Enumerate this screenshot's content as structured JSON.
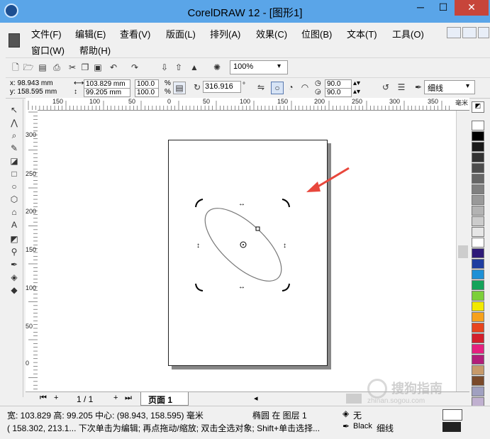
{
  "window": {
    "title": "CorelDRAW 12 - [图形1]",
    "minimize": "─",
    "restore": "☐",
    "close": "✕"
  },
  "menu": {
    "row1": [
      "文件(F)",
      "编辑(E)",
      "查看(V)",
      "版面(L)",
      "排列(A)",
      "效果(C)",
      "位图(B)",
      "文本(T)",
      "工具(O)"
    ],
    "row2": [
      "窗口(W)",
      "帮助(H)"
    ]
  },
  "toolbar": {
    "zoom": "100%",
    "x": "x: 98.943 mm",
    "y": "y: 158.595 mm",
    "width": "103.829 mm",
    "height": "99.205 mm",
    "scale_w": "100.0",
    "scale_h": "100.0",
    "percent": "%",
    "rotation": "316.916",
    "degree": "°",
    "start_angle": "90.0",
    "end_angle": "90.0",
    "outline": "细线"
  },
  "ruler": {
    "unit": "毫米",
    "h_labels": [
      "150",
      "100",
      "50",
      "0",
      "50",
      "100",
      "150",
      "200",
      "250",
      "300",
      "350"
    ],
    "v_labels": [
      "300",
      "250",
      "200",
      "150",
      "100",
      "50",
      "0"
    ]
  },
  "tabs": {
    "page_count": "1 / 1",
    "page_tab": "页面 1"
  },
  "status": {
    "line1_dims": "宽: 103.829  高: 99.205  中心: (98.943, 158.595)  毫米",
    "object": "椭圆 在 图层 1",
    "fill": "无",
    "line2": "( 158.302, 213.1...    下次单击为编辑; 再点拖动/缩放; 双击全选对象; Shift+单击选择...",
    "outline_color": "Black",
    "outline_width": "细线"
  },
  "watermark": {
    "text": "搜狗指南",
    "url": "zhinan.sogou.com"
  },
  "colors": {
    "titlebar": "#5aa5e8",
    "close": "#c7453a",
    "arrow": "#e8473c",
    "palette": [
      "#ffffff",
      "#000000",
      "#1a1a1a",
      "#333333",
      "#4d4d4d",
      "#666666",
      "#808080",
      "#999999",
      "#b3b3b3",
      "#cccccc",
      "#e6e6e6",
      "#ffffff",
      "#2e1a78",
      "#1e3da0",
      "#1e90d6",
      "#15a35a",
      "#7ccf3a",
      "#f2e900",
      "#f6a11c",
      "#e8451d",
      "#d4202c",
      "#e5207f",
      "#b21e7a",
      "#c79a6a",
      "#7a4a2a",
      "#a0a0c0",
      "#c0b0d0",
      "#8080b0",
      "#5060a0"
    ]
  }
}
